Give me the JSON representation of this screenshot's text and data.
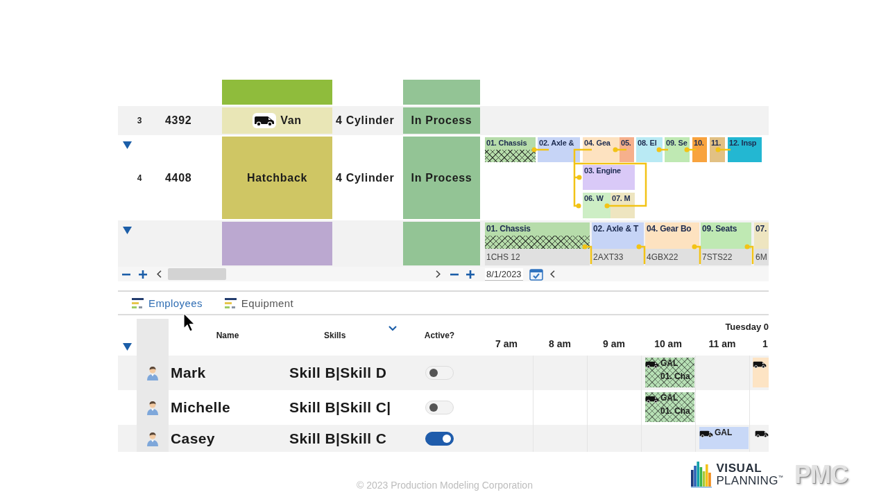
{
  "orders": [
    {
      "model": {
        "color": "#8fbc3c",
        "show_icon": false
      }
    },
    {
      "number": "3",
      "id": "4392",
      "model": {
        "label": "Van",
        "color": "#e9e6b6",
        "show_icon": true
      },
      "engine": "4 Cylinder",
      "status": "In Process"
    },
    {
      "expanded": true,
      "number": "4",
      "id": "4408",
      "model": {
        "label": "Hatchback",
        "color": "#cfc664",
        "show_icon": false
      },
      "engine": "4 Cylinder",
      "status": "In Process",
      "lanes": [
        {
          "tasks": [
            {
              "label": "01. Chassis",
              "color": "#b6dcaa",
              "hatched": true
            },
            {
              "label": "02. Axle &",
              "color": "#c6d4f6",
              "hatched": false
            },
            {
              "label": "04. Gea",
              "color": "#fde2c0",
              "hatched": false
            },
            {
              "label": "05.",
              "color": "#f6b08c",
              "hatched": false
            },
            {
              "label": "08. El",
              "color": "#b9eaf4",
              "hatched": false
            },
            {
              "label": "09. Se",
              "color": "#bfe9b3",
              "hatched": false
            },
            {
              "label": "10.",
              "color": "#f8a33e",
              "hatched": false
            },
            {
              "label": "11.",
              "color": "#e2c184",
              "hatched": false
            },
            {
              "label": "12. Insp",
              "color": "#23b7d2",
              "hatched": false
            }
          ]
        },
        {
          "tasks": [
            {
              "label": "03. Engine",
              "color": "#d9c9f7",
              "hatched": false
            }
          ]
        },
        {
          "tasks": [
            {
              "label": "06. W",
              "color": "#cdeec5",
              "hatched": false
            },
            {
              "label": "07. M",
              "color": "#eee5c0",
              "hatched": false
            }
          ]
        }
      ]
    },
    {
      "expanded": true,
      "model": {
        "color": "#bba8d0",
        "show_icon": false
      },
      "lanes": [
        {
          "tasks": [
            {
              "label": "01. Chassis",
              "code": "1CHS 12",
              "color": "#b6dcaa",
              "hatched": true
            },
            {
              "label": "02. Axle & T",
              "code": "2AXT33",
              "color": "#c6d4f6",
              "hatched": false
            },
            {
              "label": "04. Gear Bo",
              "code": "4GBX22",
              "color": "#fde2c0",
              "hatched": false
            },
            {
              "label": "09. Seats",
              "code": "7STS22",
              "color": "#bfe9b3",
              "hatched": false
            },
            {
              "label": "07.",
              "code": "6M",
              "color": "#eee5c0",
              "hatched": false
            }
          ]
        }
      ]
    }
  ],
  "scroll_bar": {
    "date": "8/1/2023"
  },
  "tabs": [
    {
      "label": "Employees",
      "selected": true
    },
    {
      "label": "Equipment",
      "selected": false
    }
  ],
  "resources": {
    "expanded": true,
    "columns": [
      "Name",
      "Skills",
      "Active?"
    ],
    "day": "Tuesday 0",
    "hours": [
      "7 am",
      "8 am",
      "9 am",
      "10 am",
      "11 am",
      "1"
    ],
    "rows": [
      {
        "name": "Mark",
        "skills": "Skill B|Skill D",
        "active": false,
        "bookings": [
          {
            "kind": "bar",
            "title": "GAL",
            "subtitle": "01. Cha",
            "color": "#b7e0b5",
            "hatched": true
          },
          {
            "kind": "bar",
            "color": "#fde4c4",
            "hatched": false
          }
        ]
      },
      {
        "name": "Michelle",
        "skills": "Skill B|Skill C|",
        "active": false,
        "bookings": [
          {
            "kind": "bar",
            "title": "GAL",
            "subtitle": "01. Cha",
            "color": "#b7e0b5",
            "hatched": true
          }
        ]
      },
      {
        "name": "Casey",
        "skills": "Skill B|Skill C",
        "active": true,
        "bookings": [
          {
            "kind": "bar",
            "title": "GAL",
            "color": "#c8d8f7",
            "hatched": false
          },
          {
            "kind": "icon"
          }
        ]
      }
    ]
  },
  "footer": {
    "copyright": "© 2023 Production Modeling Corporation",
    "logo_line_1": "VISUAL",
    "logo_line_2": "PLANNING$^{™}$",
    "logo_mark": "PMC"
  }
}
